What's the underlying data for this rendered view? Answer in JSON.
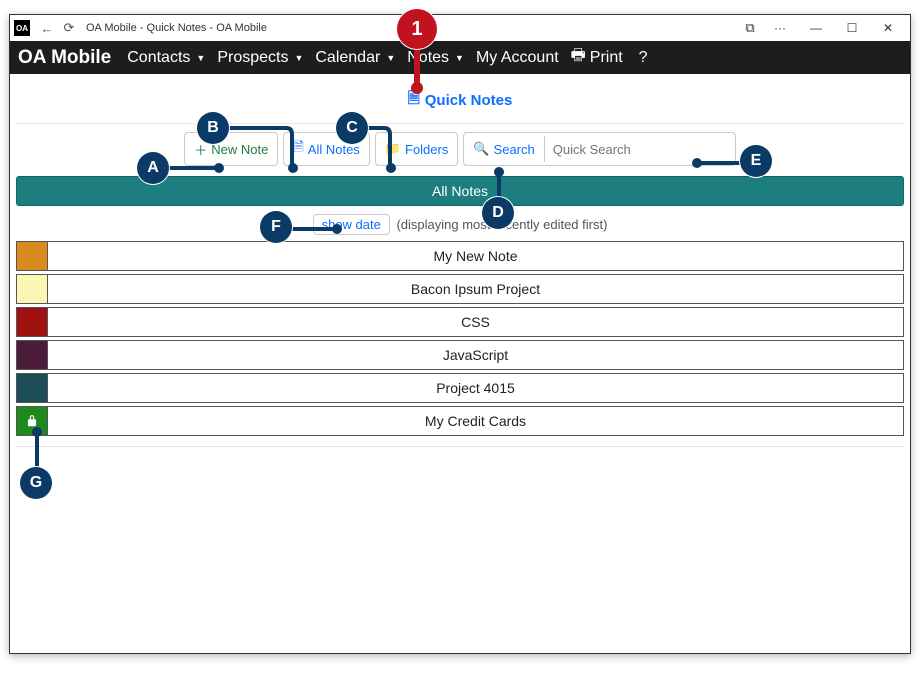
{
  "window": {
    "title": "OA Mobile - Quick Notes - OA Mobile",
    "app_icon_text": "OA"
  },
  "menubar": {
    "brand": "OA Mobile",
    "items": [
      {
        "label": "Contacts",
        "dropdown": true
      },
      {
        "label": "Prospects",
        "dropdown": true
      },
      {
        "label": "Calendar",
        "dropdown": true
      },
      {
        "label": "Notes",
        "dropdown": true
      },
      {
        "label": "My Account",
        "dropdown": false
      }
    ],
    "print": "Print",
    "help": "?"
  },
  "page": {
    "title": "Quick Notes"
  },
  "toolbar": {
    "new_note": "New Note",
    "all_notes": "All Notes",
    "folders": "Folders",
    "search": "Search",
    "quick_search_placeholder": "Quick Search"
  },
  "section": {
    "header": "All Notes",
    "show_date": "show date",
    "display_hint": "(displaying most recently edited first)"
  },
  "notes": [
    {
      "title": "My New Note",
      "color": "#d98b1d",
      "locked": false
    },
    {
      "title": "Bacon Ipsum Project",
      "color": "#fbf6b5",
      "locked": false
    },
    {
      "title": "CSS",
      "color": "#9e1212",
      "locked": false
    },
    {
      "title": "JavaScript",
      "color": "#4c1d3a",
      "locked": false
    },
    {
      "title": "Project 4015",
      "color": "#1b4d57",
      "locked": false
    },
    {
      "title": "My Credit Cards",
      "color": "#1c8a1c",
      "locked": true
    }
  ],
  "callouts": {
    "top": "1",
    "A": "A",
    "B": "B",
    "C": "C",
    "D": "D",
    "E": "E",
    "F": "F",
    "G": "G"
  }
}
